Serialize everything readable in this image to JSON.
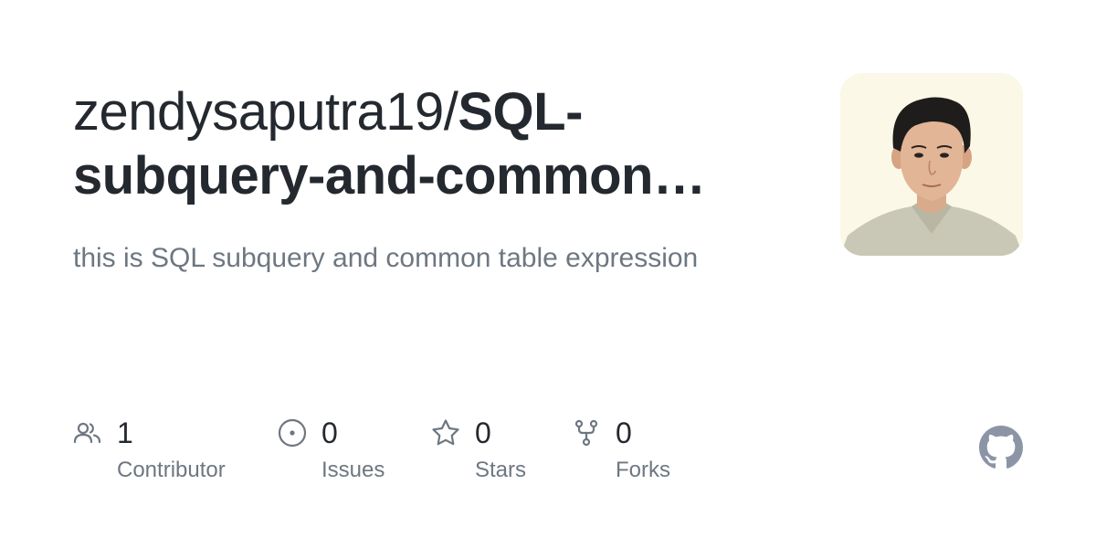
{
  "repo": {
    "owner": "zendysaputra19/",
    "name": "SQL-subquery-and-common…",
    "description": "this is SQL subquery and common table expression"
  },
  "stats": [
    {
      "icon": "contributors-icon",
      "value": "1",
      "label": "Contributor"
    },
    {
      "icon": "issues-icon",
      "value": "0",
      "label": "Issues"
    },
    {
      "icon": "star-icon",
      "value": "0",
      "label": "Stars"
    },
    {
      "icon": "fork-icon",
      "value": "0",
      "label": "Forks"
    }
  ],
  "colors": {
    "text_primary": "#24292f",
    "text_secondary": "#6e7781",
    "icon": "#6e7781",
    "github_logo": "#8c95a6",
    "avatar_background": "#fbf8e8"
  },
  "brand": {
    "logo": "github-logo-icon"
  }
}
